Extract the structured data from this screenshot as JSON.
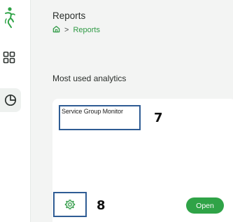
{
  "colors": {
    "accent_green": "#2fa347",
    "callout_border": "#2f5c94",
    "background": "#f3f4f3"
  },
  "sidebar": {
    "logo_icon": "runner-logo-icon",
    "items": [
      {
        "icon": "grid-icon"
      },
      {
        "icon": "pie-chart-icon",
        "active": true
      }
    ]
  },
  "header": {
    "title": "Reports",
    "breadcrumb": {
      "home_icon": "home-icon",
      "separator": ">",
      "current": "Reports"
    }
  },
  "section": {
    "title": "Most used analytics"
  },
  "card": {
    "title": "Service Group Monitor",
    "settings_icon": "gear-icon",
    "open_label": "Open"
  },
  "callouts": {
    "title_marker": "7",
    "settings_marker": "8"
  }
}
